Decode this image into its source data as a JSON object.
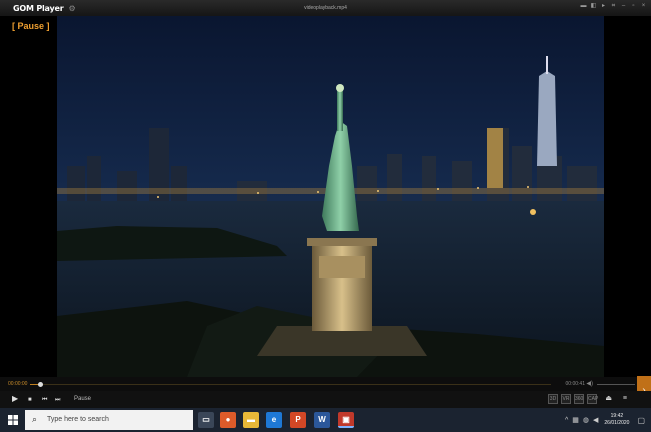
{
  "app": {
    "logo": "GOM Player",
    "window_title": "videoplayback.mp4"
  },
  "osd": {
    "status": "[ Pause ]"
  },
  "seek": {
    "elapsed": "00:00:00",
    "total": "00:00:41",
    "progress": 0.02
  },
  "controls": {
    "status_text": "Pause",
    "right_buttons": [
      "3D",
      "VR",
      "360",
      "CAP"
    ]
  },
  "taskbar": {
    "search_placeholder": "Type here to search",
    "clock_time": "19:42",
    "clock_date": "26/01/2020",
    "apps": [
      {
        "name": "task-view",
        "color": "#3a4658",
        "glyph": "▭"
      },
      {
        "name": "chrome",
        "color": "#dd5b2a",
        "glyph": "●"
      },
      {
        "name": "file-explorer",
        "color": "#e8b838",
        "glyph": "▬"
      },
      {
        "name": "edge",
        "color": "#1e78d6",
        "glyph": "e"
      },
      {
        "name": "powerpoint",
        "color": "#d24726",
        "glyph": "P"
      },
      {
        "name": "word",
        "color": "#2b579a",
        "glyph": "W"
      },
      {
        "name": "gom-player",
        "color": "#c0392b",
        "glyph": "▣"
      }
    ]
  },
  "colors": {
    "accent": "#f0a030",
    "taskbar": "#1b2330"
  }
}
